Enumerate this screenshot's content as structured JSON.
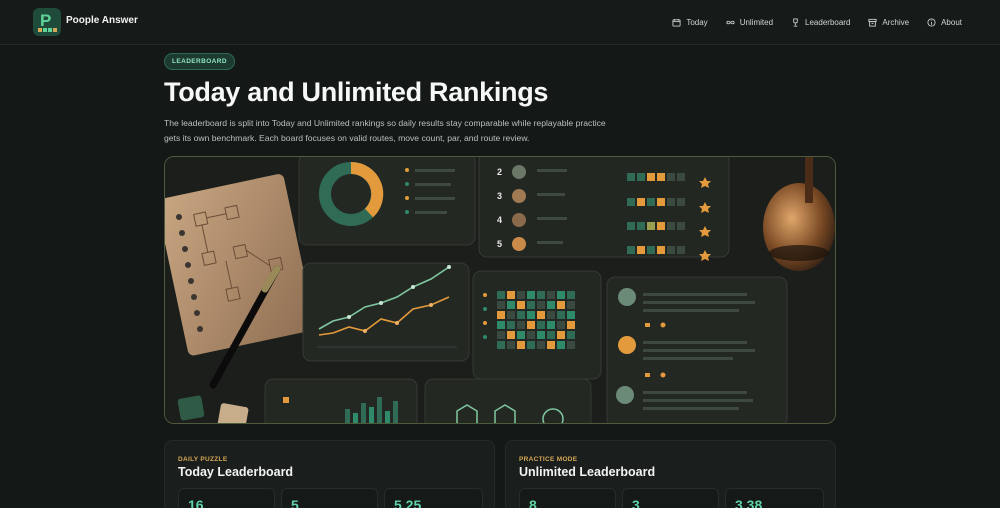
{
  "app": {
    "name": "Poople Answer"
  },
  "nav": [
    {
      "label": "Today",
      "icon": "calendar-icon"
    },
    {
      "label": "Unlimited",
      "icon": "infinity-icon"
    },
    {
      "label": "Leaderboard",
      "icon": "trophy-icon"
    },
    {
      "label": "Archive",
      "icon": "archive-icon"
    },
    {
      "label": "About",
      "icon": "info-icon"
    }
  ],
  "hero": {
    "badge": "LEADERBOARD",
    "title": "Today and Unlimited Rankings",
    "description": "The leaderboard is split into Today and Unlimited rankings so daily results stay comparable while replayable practice gets its own benchmark. Each board focuses on valid routes, move count, par, and route review."
  },
  "illustration": {
    "ranks": [
      "2",
      "3",
      "4",
      "5"
    ]
  },
  "boards": [
    {
      "kicker": "DAILY PUZZLE",
      "title": "Today Leaderboard",
      "stats": [
        "16",
        "5",
        "5.25"
      ]
    },
    {
      "kicker": "PRACTICE MODE",
      "title": "Unlimited Leaderboard",
      "stats": [
        "8",
        "3",
        "3.38"
      ]
    }
  ],
  "colors": {
    "accent": "#5fd3a6",
    "gold": "#d6a857",
    "orange": "#e39a3c",
    "bg": "#141816"
  }
}
